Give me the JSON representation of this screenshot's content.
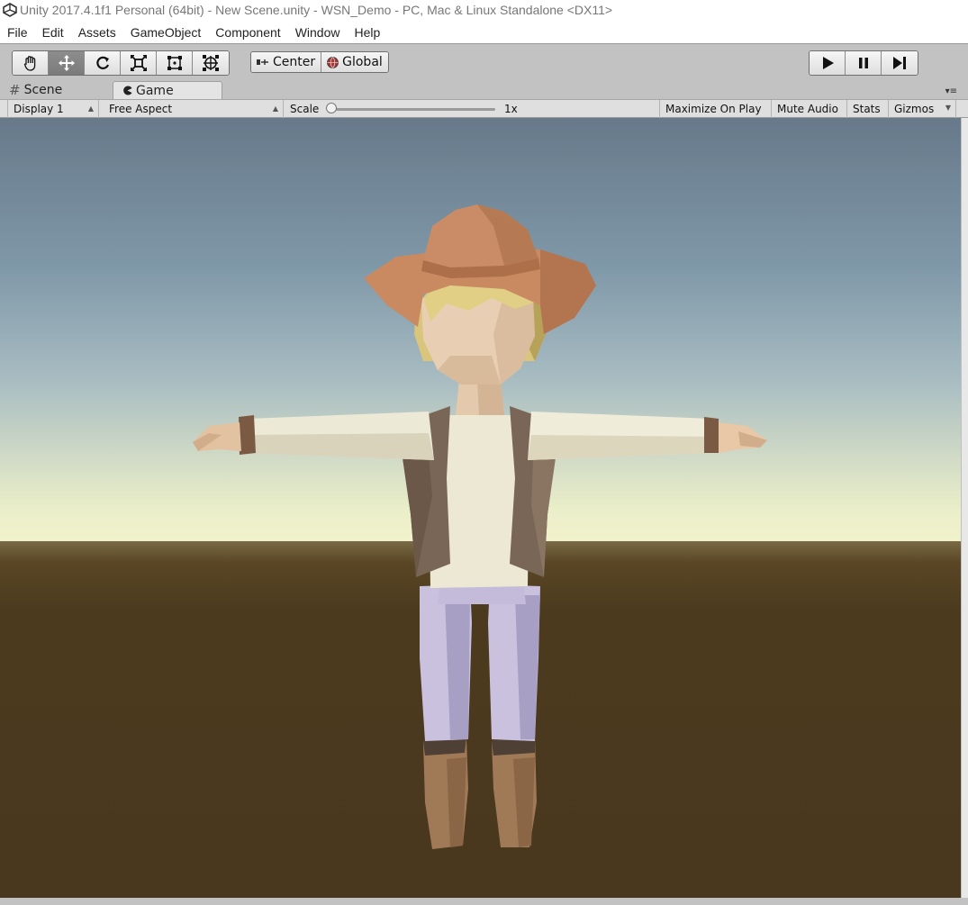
{
  "window": {
    "title": "Unity 2017.4.1f1 Personal (64bit) - New Scene.unity - WSN_Demo - PC, Mac & Linux Standalone <DX11>"
  },
  "menu": [
    "File",
    "Edit",
    "Assets",
    "GameObject",
    "Component",
    "Window",
    "Help"
  ],
  "toolbar": {
    "tools": [
      "hand-tool-icon",
      "move-tool-icon",
      "rotate-tool-icon",
      "scale-tool-icon",
      "rect-tool-icon",
      "transform-tool-icon"
    ],
    "active_tool": "move-tool-icon",
    "pivot_mode": "Center",
    "pivot_space": "Global",
    "playback": [
      "play-icon",
      "pause-icon",
      "step-icon"
    ]
  },
  "tabs": {
    "scene": "Scene",
    "game": "Game",
    "active": "Game"
  },
  "game_toolbar": {
    "display": "Display 1",
    "aspect": "Free Aspect",
    "scale_label": "Scale",
    "scale_value": "1x",
    "scale_fraction": 0.0,
    "maximize_on_play": "Maximize On Play",
    "mute_audio": "Mute Audio",
    "stats": "Stats",
    "gizmos": "Gizmos"
  },
  "colors": {
    "toolbar_bg": "#c2c2c2",
    "sky_top": "#67798a",
    "horizon": "#f1f2cc",
    "ground": "#4a381e"
  }
}
